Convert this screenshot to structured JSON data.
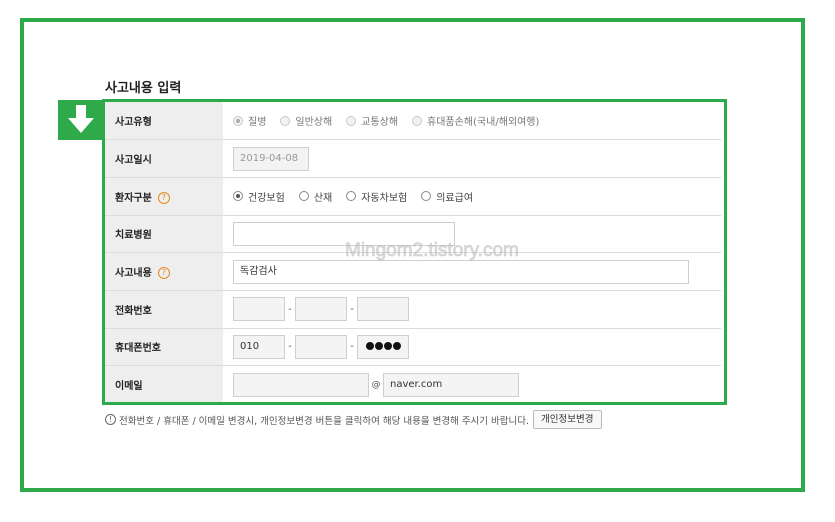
{
  "section": {
    "title": "사고내용 입력"
  },
  "form": {
    "accident_type": {
      "label": "사고유형",
      "options": [
        {
          "label": "질병",
          "checked": true
        },
        {
          "label": "일반상해",
          "checked": false
        },
        {
          "label": "교통상해",
          "checked": false
        },
        {
          "label": "휴대품손해(국내/해외여행)",
          "checked": false
        }
      ]
    },
    "accident_date": {
      "label": "사고일시",
      "value": "2019-04-08"
    },
    "patient_type": {
      "label": "환자구분",
      "help_icon": "help-icon",
      "options": [
        {
          "label": "건강보험",
          "checked": true
        },
        {
          "label": "산재",
          "checked": false
        },
        {
          "label": "자동차보험",
          "checked": false
        },
        {
          "label": "의료급여",
          "checked": false
        }
      ]
    },
    "hospital": {
      "label": "치료병원",
      "value": ""
    },
    "accident_detail": {
      "label": "사고내용",
      "help_icon": "help-icon",
      "value": "독감검사"
    },
    "phone": {
      "label": "전화번호",
      "part1": "",
      "part2": "",
      "part3": "",
      "separator": "-"
    },
    "mobile": {
      "label": "휴대폰번호",
      "part1": "010",
      "part2": "",
      "separator": "-",
      "masked_digits": 4
    },
    "email": {
      "label": "이메일",
      "local": "",
      "at": "@",
      "domain": "naver.com"
    }
  },
  "notice": {
    "icon": "info-icon",
    "text": "전화번호 / 휴대폰 / 이메일 변경시, 개인정보변경 버튼을 클릭하여 해당 내용을 변경해 주시기 바랍니다.",
    "button_label": "개인정보변경"
  },
  "watermark": "Mingom2.tistory.com",
  "colors": {
    "highlight": "#2eaa4a"
  }
}
